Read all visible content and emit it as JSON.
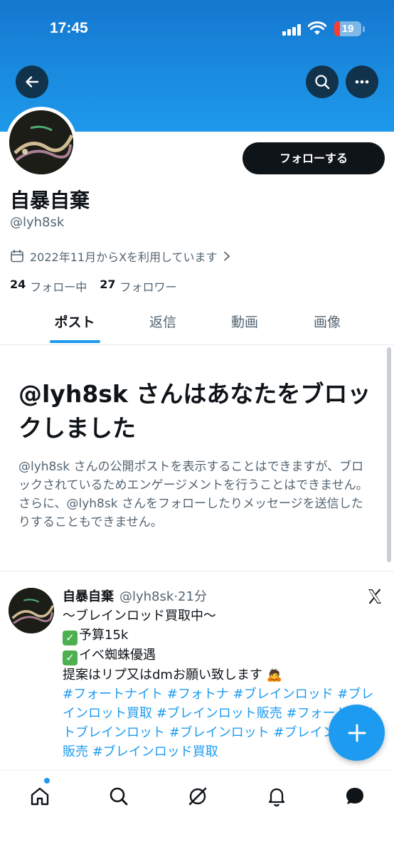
{
  "status_bar": {
    "time": "17:45",
    "battery": "19"
  },
  "header": {
    "back_icon": "arrow-left-icon",
    "search_icon": "search-icon",
    "more_icon": "more-horizontal-icon"
  },
  "profile": {
    "display_name": "自暴自棄",
    "handle": "@lyh8sk",
    "follow_button": "フォローする",
    "joined": "2022年11月からXを利用しています",
    "following_count": "24",
    "following_label": "フォロー中",
    "followers_count": "27",
    "followers_label": "フォロワー"
  },
  "tabs": [
    {
      "label": "ポスト",
      "active": true
    },
    {
      "label": "返信",
      "active": false
    },
    {
      "label": "動画",
      "active": false
    },
    {
      "label": "画像",
      "active": false
    }
  ],
  "blocked_notice": {
    "title": "@lyh8sk さんはあなたをブロックしました",
    "description": "@lyh8sk さんの公開ポストを表示することはできますが、ブロックされているためエンゲージメントを行うことはできません。さらに、@lyh8sk さんをフォローしたりメッセージを送信したりすることもできません。"
  },
  "post": {
    "author": "自暴自棄",
    "meta": "@lyh8sk·21分",
    "lines": [
      "〜ブレインロッド買取中〜",
      "予算15k",
      "イベ蜘蛛優遇",
      "提案はリプ又はdmお願い致します 🙇"
    ],
    "hashtags": " #フォートナイト #フォトナ #ブレインロッド #ブレインロット買取 #ブレインロット販売 #フォートナイトブレインロット #ブレインロット #ブレインロッド販売 #ブレインロッド買取"
  },
  "bottom_nav": [
    "home-icon",
    "search-icon",
    "grok-icon",
    "notifications-icon",
    "messages-icon"
  ],
  "colors": {
    "accent": "#1d9bf0",
    "banner": "#1a8de0",
    "text": "#0f1419",
    "secondary": "#536471"
  }
}
